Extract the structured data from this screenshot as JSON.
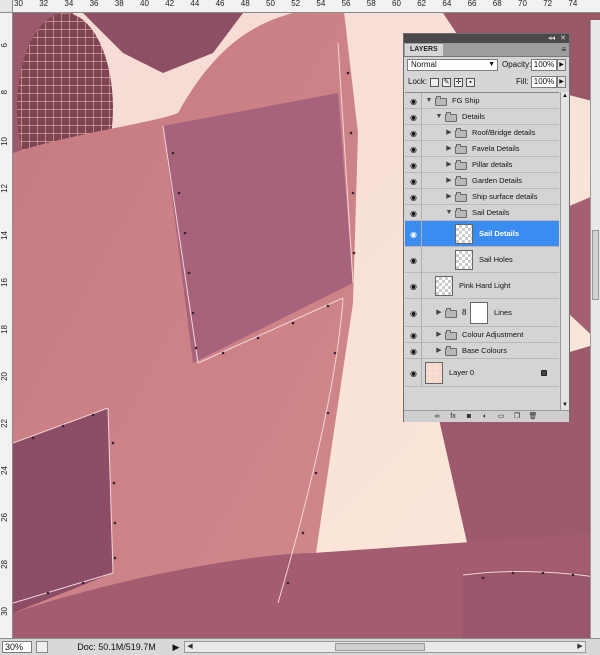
{
  "rulers": {
    "top_labels": [
      "30",
      "32",
      "34",
      "36",
      "38",
      "40",
      "42",
      "44",
      "46",
      "48",
      "50",
      "52",
      "54",
      "56",
      "58",
      "60",
      "62",
      "64",
      "66",
      "68",
      "70",
      "72",
      "74"
    ],
    "left_labels": [
      "6",
      "8",
      "10",
      "12",
      "14",
      "16",
      "18",
      "20",
      "22",
      "24",
      "26",
      "28",
      "30"
    ]
  },
  "status": {
    "zoom": "30%",
    "doc": "Doc: 50.1M/519.7M",
    "arrow": "▶"
  },
  "panel": {
    "tab": "LAYERS",
    "collapse": "◂◂",
    "close": "✕",
    "menu": "≡",
    "blend_mode": "Normal",
    "opacity_label": "Opacity:",
    "opacity_value": "100%",
    "lock_label": "Lock:",
    "fill_label": "Fill:",
    "fill_value": "100%",
    "footer_icons": [
      "link-icon",
      "fx-icon",
      "mask-icon",
      "adjustment-icon",
      "group-icon",
      "new-layer-icon",
      "trash-icon"
    ]
  },
  "layers": [
    {
      "name": "FG Ship",
      "depth": 0,
      "type": "folder",
      "expanded": true
    },
    {
      "name": "Details",
      "depth": 1,
      "type": "folder",
      "expanded": true
    },
    {
      "name": "Roof/Bridge details",
      "depth": 2,
      "type": "folder",
      "expanded": false
    },
    {
      "name": "Favela Details",
      "depth": 2,
      "type": "folder",
      "expanded": false
    },
    {
      "name": "Pillar details",
      "depth": 2,
      "type": "folder",
      "expanded": false
    },
    {
      "name": "Garden Details",
      "depth": 2,
      "type": "folder",
      "expanded": false
    },
    {
      "name": "Ship surface details",
      "depth": 2,
      "type": "folder",
      "expanded": false
    },
    {
      "name": "Sail Details",
      "depth": 2,
      "type": "folder",
      "expanded": true
    },
    {
      "name": "Sail Details",
      "depth": 3,
      "type": "layer",
      "selected": true
    },
    {
      "name": "Sail Holes",
      "depth": 3,
      "type": "layer"
    },
    {
      "name": "Pink Hard Light",
      "depth": 1,
      "type": "layer"
    },
    {
      "name": "Lines",
      "depth": 1,
      "type": "masked-folder",
      "expanded": false
    },
    {
      "name": "Colour Adjustment",
      "depth": 1,
      "type": "folder",
      "expanded": false
    },
    {
      "name": "Base Colours",
      "depth": 1,
      "type": "folder",
      "expanded": false
    },
    {
      "name": "Layer 0",
      "depth": 0,
      "type": "background",
      "locked": true
    }
  ],
  "colors": {
    "selection": "#3b8cf0",
    "sail_main": "#c98086",
    "sail_dark": "#a3607a",
    "sky": "#f7dcd5"
  }
}
